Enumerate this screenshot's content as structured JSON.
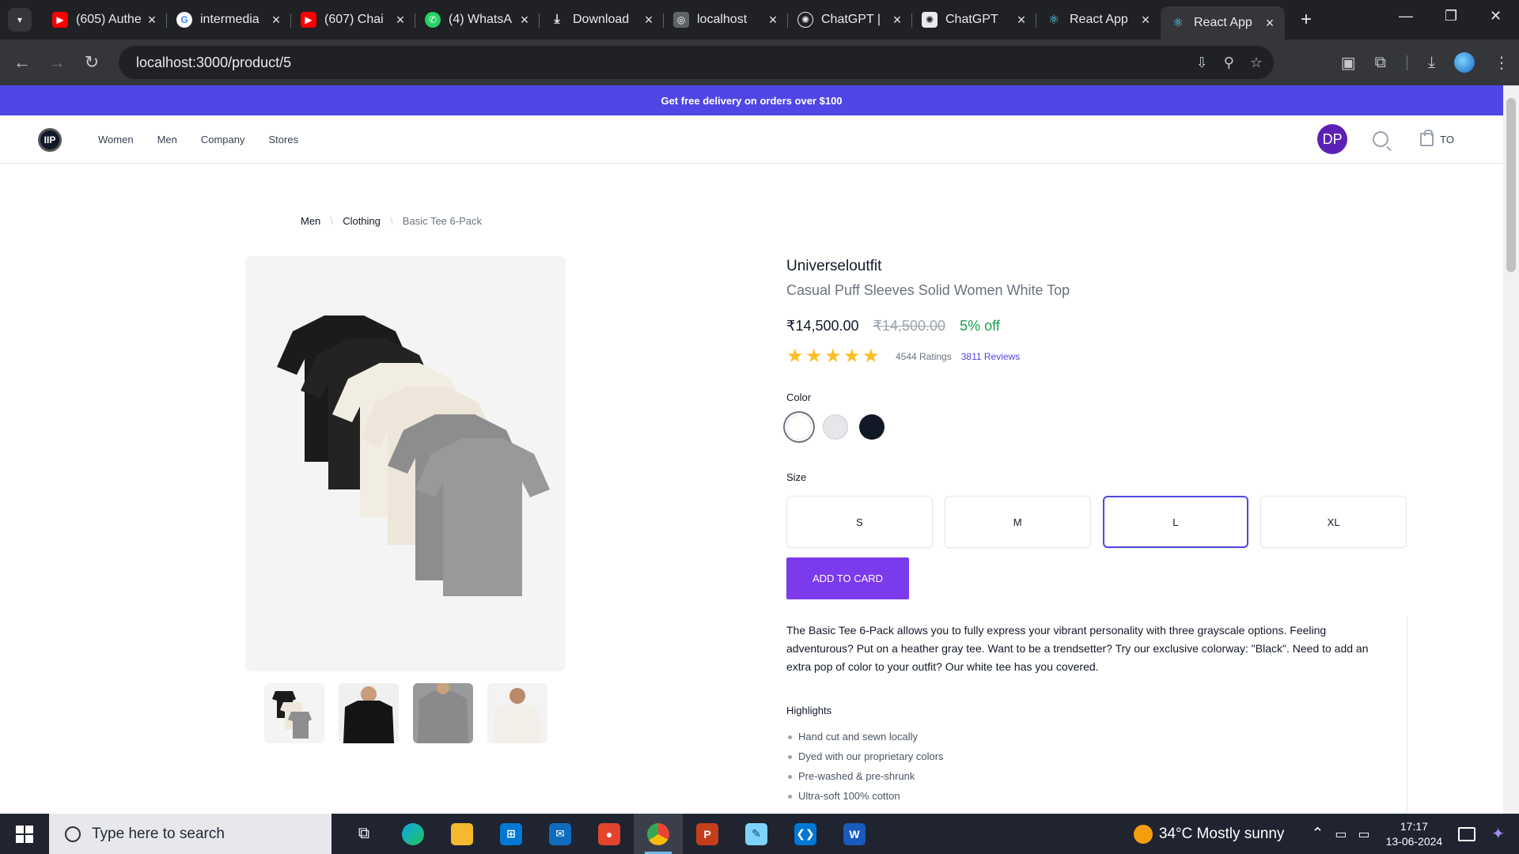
{
  "browser": {
    "tabs": [
      {
        "title": "(605) Authe",
        "icon": "youtube-icon",
        "color": "#ff0000"
      },
      {
        "title": "intermedia",
        "icon": "google-icon",
        "color": "#ffffff"
      },
      {
        "title": "(607) Chai",
        "icon": "youtube-icon",
        "color": "#ff0000"
      },
      {
        "title": "(4) WhatsA",
        "icon": "whatsapp-icon",
        "color": "#25d366"
      },
      {
        "title": "Download",
        "icon": "download-icon",
        "color": "#202124"
      },
      {
        "title": "localhost",
        "icon": "globe-icon",
        "color": "#5f6368"
      },
      {
        "title": "ChatGPT | ",
        "icon": "chatgpt-icon",
        "color": "#202124"
      },
      {
        "title": "ChatGPT",
        "icon": "chatgpt-icon",
        "color": "#202124"
      },
      {
        "title": "React App",
        "icon": "react-icon",
        "color": "#202124"
      },
      {
        "title": "React App",
        "icon": "react-icon",
        "color": "#35363a"
      }
    ],
    "url": "localhost:3000/product/5"
  },
  "promo": "Get free delivery on orders over $100",
  "nav": {
    "logo": "IIP",
    "menu": [
      "Women",
      "Men",
      "Company",
      "Stores"
    ],
    "avatar": "DP",
    "cart_label": "TO"
  },
  "breadcrumb": {
    "items": [
      "Men",
      "Clothing"
    ],
    "current": "Basic Tee 6-Pack"
  },
  "product": {
    "brand": "Universeloutfit",
    "title": "Casual Puff Sleeves Solid Women White Top",
    "price": "₹14,500.00",
    "mrp": "₹14,500.00",
    "discount": "5% off",
    "ratings": "4544 Ratings",
    "reviews": "3811 Reviews",
    "stars": 5,
    "color_label": "Color",
    "colors": [
      "#ffffff",
      "#e5e7eb",
      "#111827"
    ],
    "size_label": "Size",
    "sizes": [
      "S",
      "M",
      "L",
      "XL"
    ],
    "selected_size": "L",
    "add_button": "ADD TO CARD",
    "description": "The Basic Tee 6-Pack allows you to fully express your vibrant personality with three grayscale options. Feeling adventurous? Put on a heather gray tee. Want to be a trendsetter? Try our exclusive colorway: \"Black\". Need to add an extra pop of color to your outfit? Our white tee has you covered.",
    "highlights_label": "Highlights",
    "highlights": [
      "Hand cut and sewn locally",
      "Dyed with our proprietary colors",
      "Pre-washed & pre-shrunk",
      "Ultra-soft 100% cotton"
    ]
  },
  "taskbar": {
    "search_placeholder": "Type here to search",
    "weather": "34°C  Mostly sunny",
    "time": "17:17",
    "date": "13-06-2024"
  }
}
